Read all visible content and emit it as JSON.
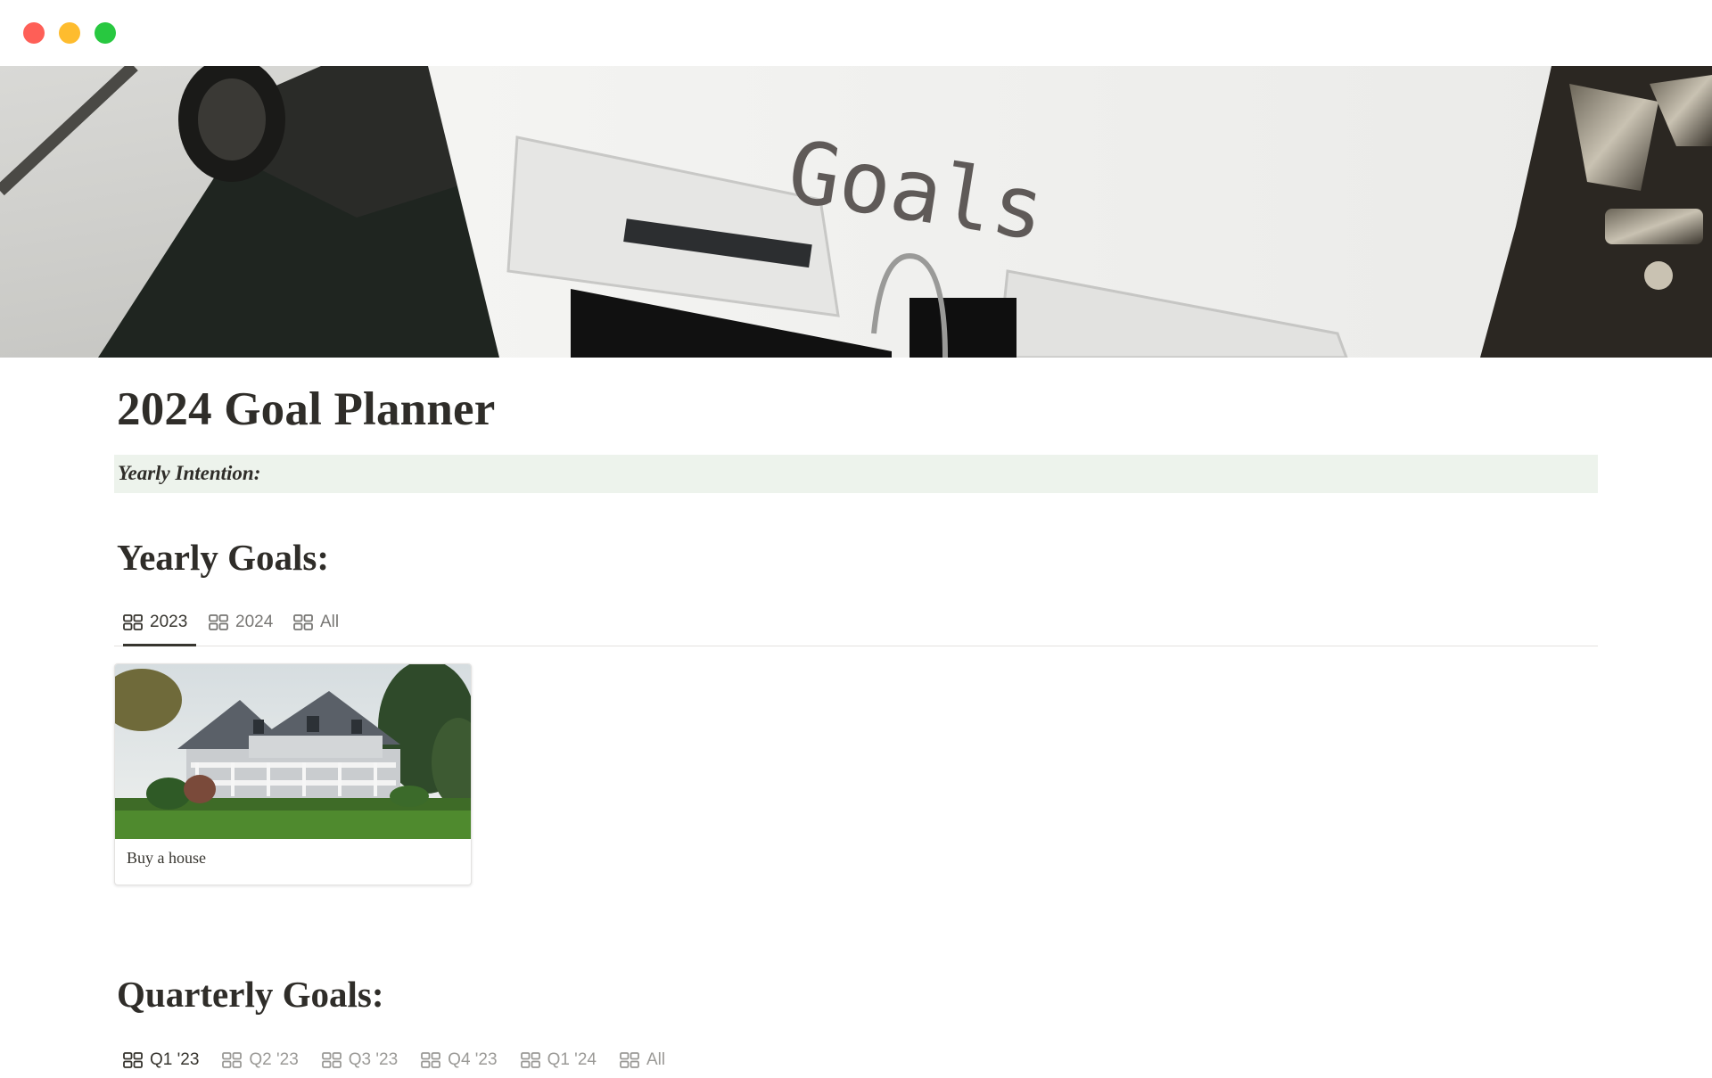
{
  "window": {
    "controls": [
      "close",
      "minimize",
      "zoom"
    ],
    "colors": {
      "close": "#fe5f57",
      "minimize": "#febc2e",
      "zoom": "#28c840"
    }
  },
  "cover": {
    "image": "typewriter-goals-photo",
    "text": "Goals"
  },
  "page": {
    "title": "2024 Goal Planner"
  },
  "callout": {
    "text": "Yearly Intention:",
    "background": "#edf3ec"
  },
  "yearly": {
    "heading": "Yearly Goals:",
    "views": [
      {
        "label": "2023",
        "icon": "gallery-icon",
        "active": true
      },
      {
        "label": "2024",
        "icon": "gallery-icon",
        "active": false
      },
      {
        "label": "All",
        "icon": "gallery-icon",
        "active": false
      }
    ],
    "cards": [
      {
        "title": "Buy a house",
        "image": "house-photo"
      }
    ]
  },
  "quarterly": {
    "heading": "Quarterly Goals:",
    "views": [
      {
        "label": "Q1 '23",
        "icon": "gallery-icon",
        "active": true
      },
      {
        "label": "Q2 '23",
        "icon": "gallery-icon",
        "active": false
      },
      {
        "label": "Q3 '23",
        "icon": "gallery-icon",
        "active": false
      },
      {
        "label": "Q4 '23",
        "icon": "gallery-icon",
        "active": false
      },
      {
        "label": "Q1 '24",
        "icon": "gallery-icon",
        "active": false
      },
      {
        "label": "All",
        "icon": "gallery-icon",
        "active": false
      }
    ]
  }
}
